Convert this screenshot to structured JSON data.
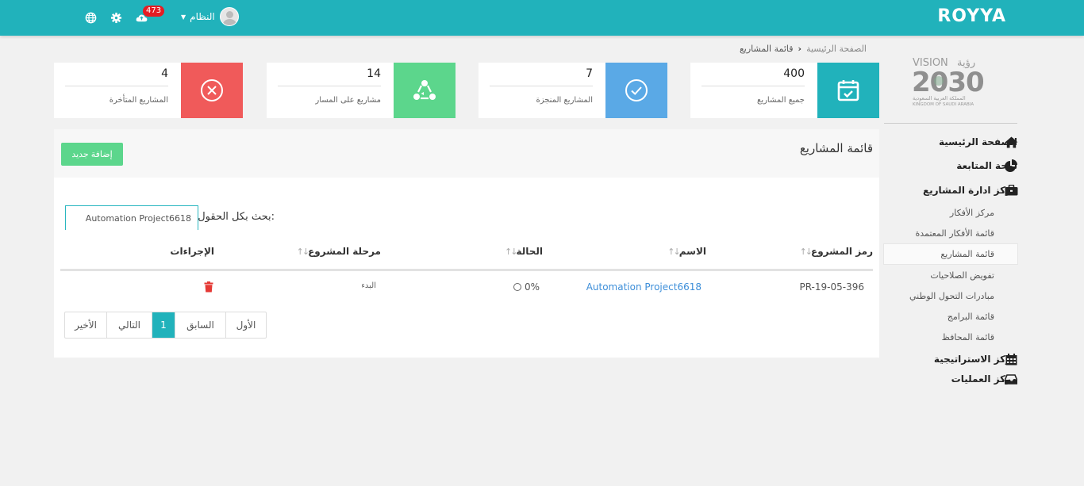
{
  "brand": "ROYYA",
  "header": {
    "user_name": "النظام",
    "notification_count": "473"
  },
  "breadcrumb": {
    "home": "الصفحة الرئيسية",
    "current": "قائمة المشاريع"
  },
  "stats": [
    {
      "value": "400",
      "label": "جميع المشاريع",
      "color": "#21b2bb",
      "icon": "calendar-check-icon"
    },
    {
      "value": "7",
      "label": "المشاريع المنجزة",
      "color": "#5aa9e6",
      "icon": "check-circle-icon"
    },
    {
      "value": "14",
      "label": "مشاريع على المسار",
      "color": "#5cd68c",
      "icon": "recycle-icon"
    },
    {
      "value": "4",
      "label": "المشاريع المتأخرة",
      "color": "#f05a5a",
      "icon": "times-circle-icon"
    }
  ],
  "panel": {
    "title": "قائمة المشاريع",
    "add_button": "إضافة جديد",
    "search_label": "بحث بكل الحقول:",
    "search_value": "Automation Project6618"
  },
  "table": {
    "columns": [
      "رمز المشروع",
      "الاسم",
      "الحالة",
      "مرحلة المشروع",
      "الإجراءات"
    ],
    "rows": [
      {
        "code": "PR-19-05-396",
        "name": "Automation Project6618",
        "status": "0%",
        "stage": "البدء"
      }
    ]
  },
  "pagination": {
    "first": "الأول",
    "prev": "السابق",
    "current": "1",
    "next": "التالي",
    "last": "الأخير"
  },
  "logo": {
    "vision": "VISION",
    "arabic_vision": "رؤية",
    "year": "2030",
    "kingdom_ar": "المملكة العربية السعودية",
    "kingdom_en": "KINGDOM OF SAUDI ARABIA"
  },
  "sidebar": {
    "items": [
      {
        "label": "الصفحة الرئيسية",
        "icon": "home-icon"
      },
      {
        "label": "لوحة المتابعة",
        "icon": "pie-chart-icon"
      },
      {
        "label": "مركز ادارة المشاريع",
        "icon": "briefcase-icon"
      }
    ],
    "subitems": [
      "مركز الأفكار",
      "قائمة الأفكار المعتمدة",
      "قائمة المشاريع",
      "تفويض الصلاحيات",
      "مبادرات التحول الوطني",
      "قائمة البرامج",
      "قائمة المحافظ"
    ],
    "bottom_items": [
      {
        "label": "مركز الاستراتيجية",
        "icon": "calendar-icon"
      },
      {
        "label": "مركز العمليات",
        "icon": "inbox-icon"
      }
    ]
  }
}
